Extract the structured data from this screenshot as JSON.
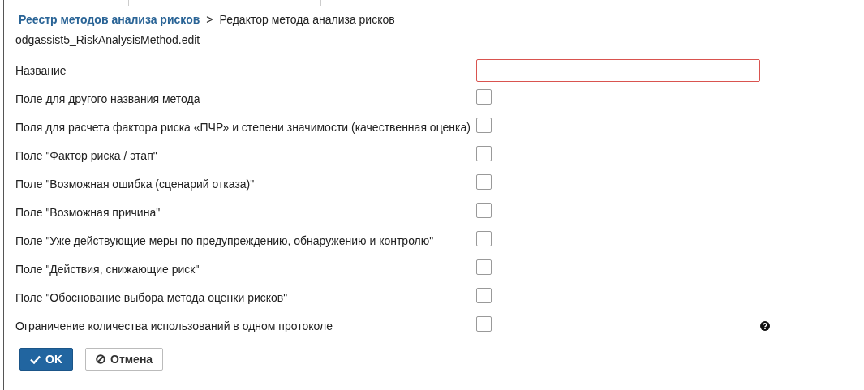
{
  "breadcrumb": {
    "parent": "Реестр методов анализа рисков",
    "separator": ">",
    "current": "Редактор метода анализа рисков"
  },
  "screen_id": "odgassist5_RiskAnalysisMethod.edit",
  "fields": [
    {
      "kind": "text",
      "label": "Название",
      "invalid": true
    },
    {
      "kind": "checkbox",
      "label": "Поле для другого названия метода",
      "checked": false
    },
    {
      "kind": "checkbox",
      "label": "Поля для расчета фактора риска «ПЧР» и степени значимости (качественная оценка)",
      "checked": false
    },
    {
      "kind": "checkbox",
      "label": "Поле \"Фактор риска / этап\"",
      "checked": false
    },
    {
      "kind": "checkbox",
      "label": "Поле \"Возможная ошибка (сценарий отказа)\"",
      "checked": false
    },
    {
      "kind": "checkbox",
      "label": "Поле \"Возможная причина\"",
      "checked": false
    },
    {
      "kind": "checkbox",
      "label": "Поле \"Уже действующие меры по предупреждению, обнаружению и контролю\"",
      "checked": false
    },
    {
      "kind": "checkbox",
      "label": "Поле \"Действия, снижающие риск\"",
      "checked": false
    },
    {
      "kind": "checkbox",
      "label": "Поле \"Обоснование выбора метода оценки рисков\"",
      "checked": false
    },
    {
      "kind": "checkbox",
      "label": "Ограничение количества использований в одном протоколе",
      "checked": false,
      "help": true
    }
  ],
  "buttons": [
    {
      "kind": "primary",
      "label": "OK"
    },
    {
      "kind": "cancel",
      "label": "Отмена"
    }
  ]
}
